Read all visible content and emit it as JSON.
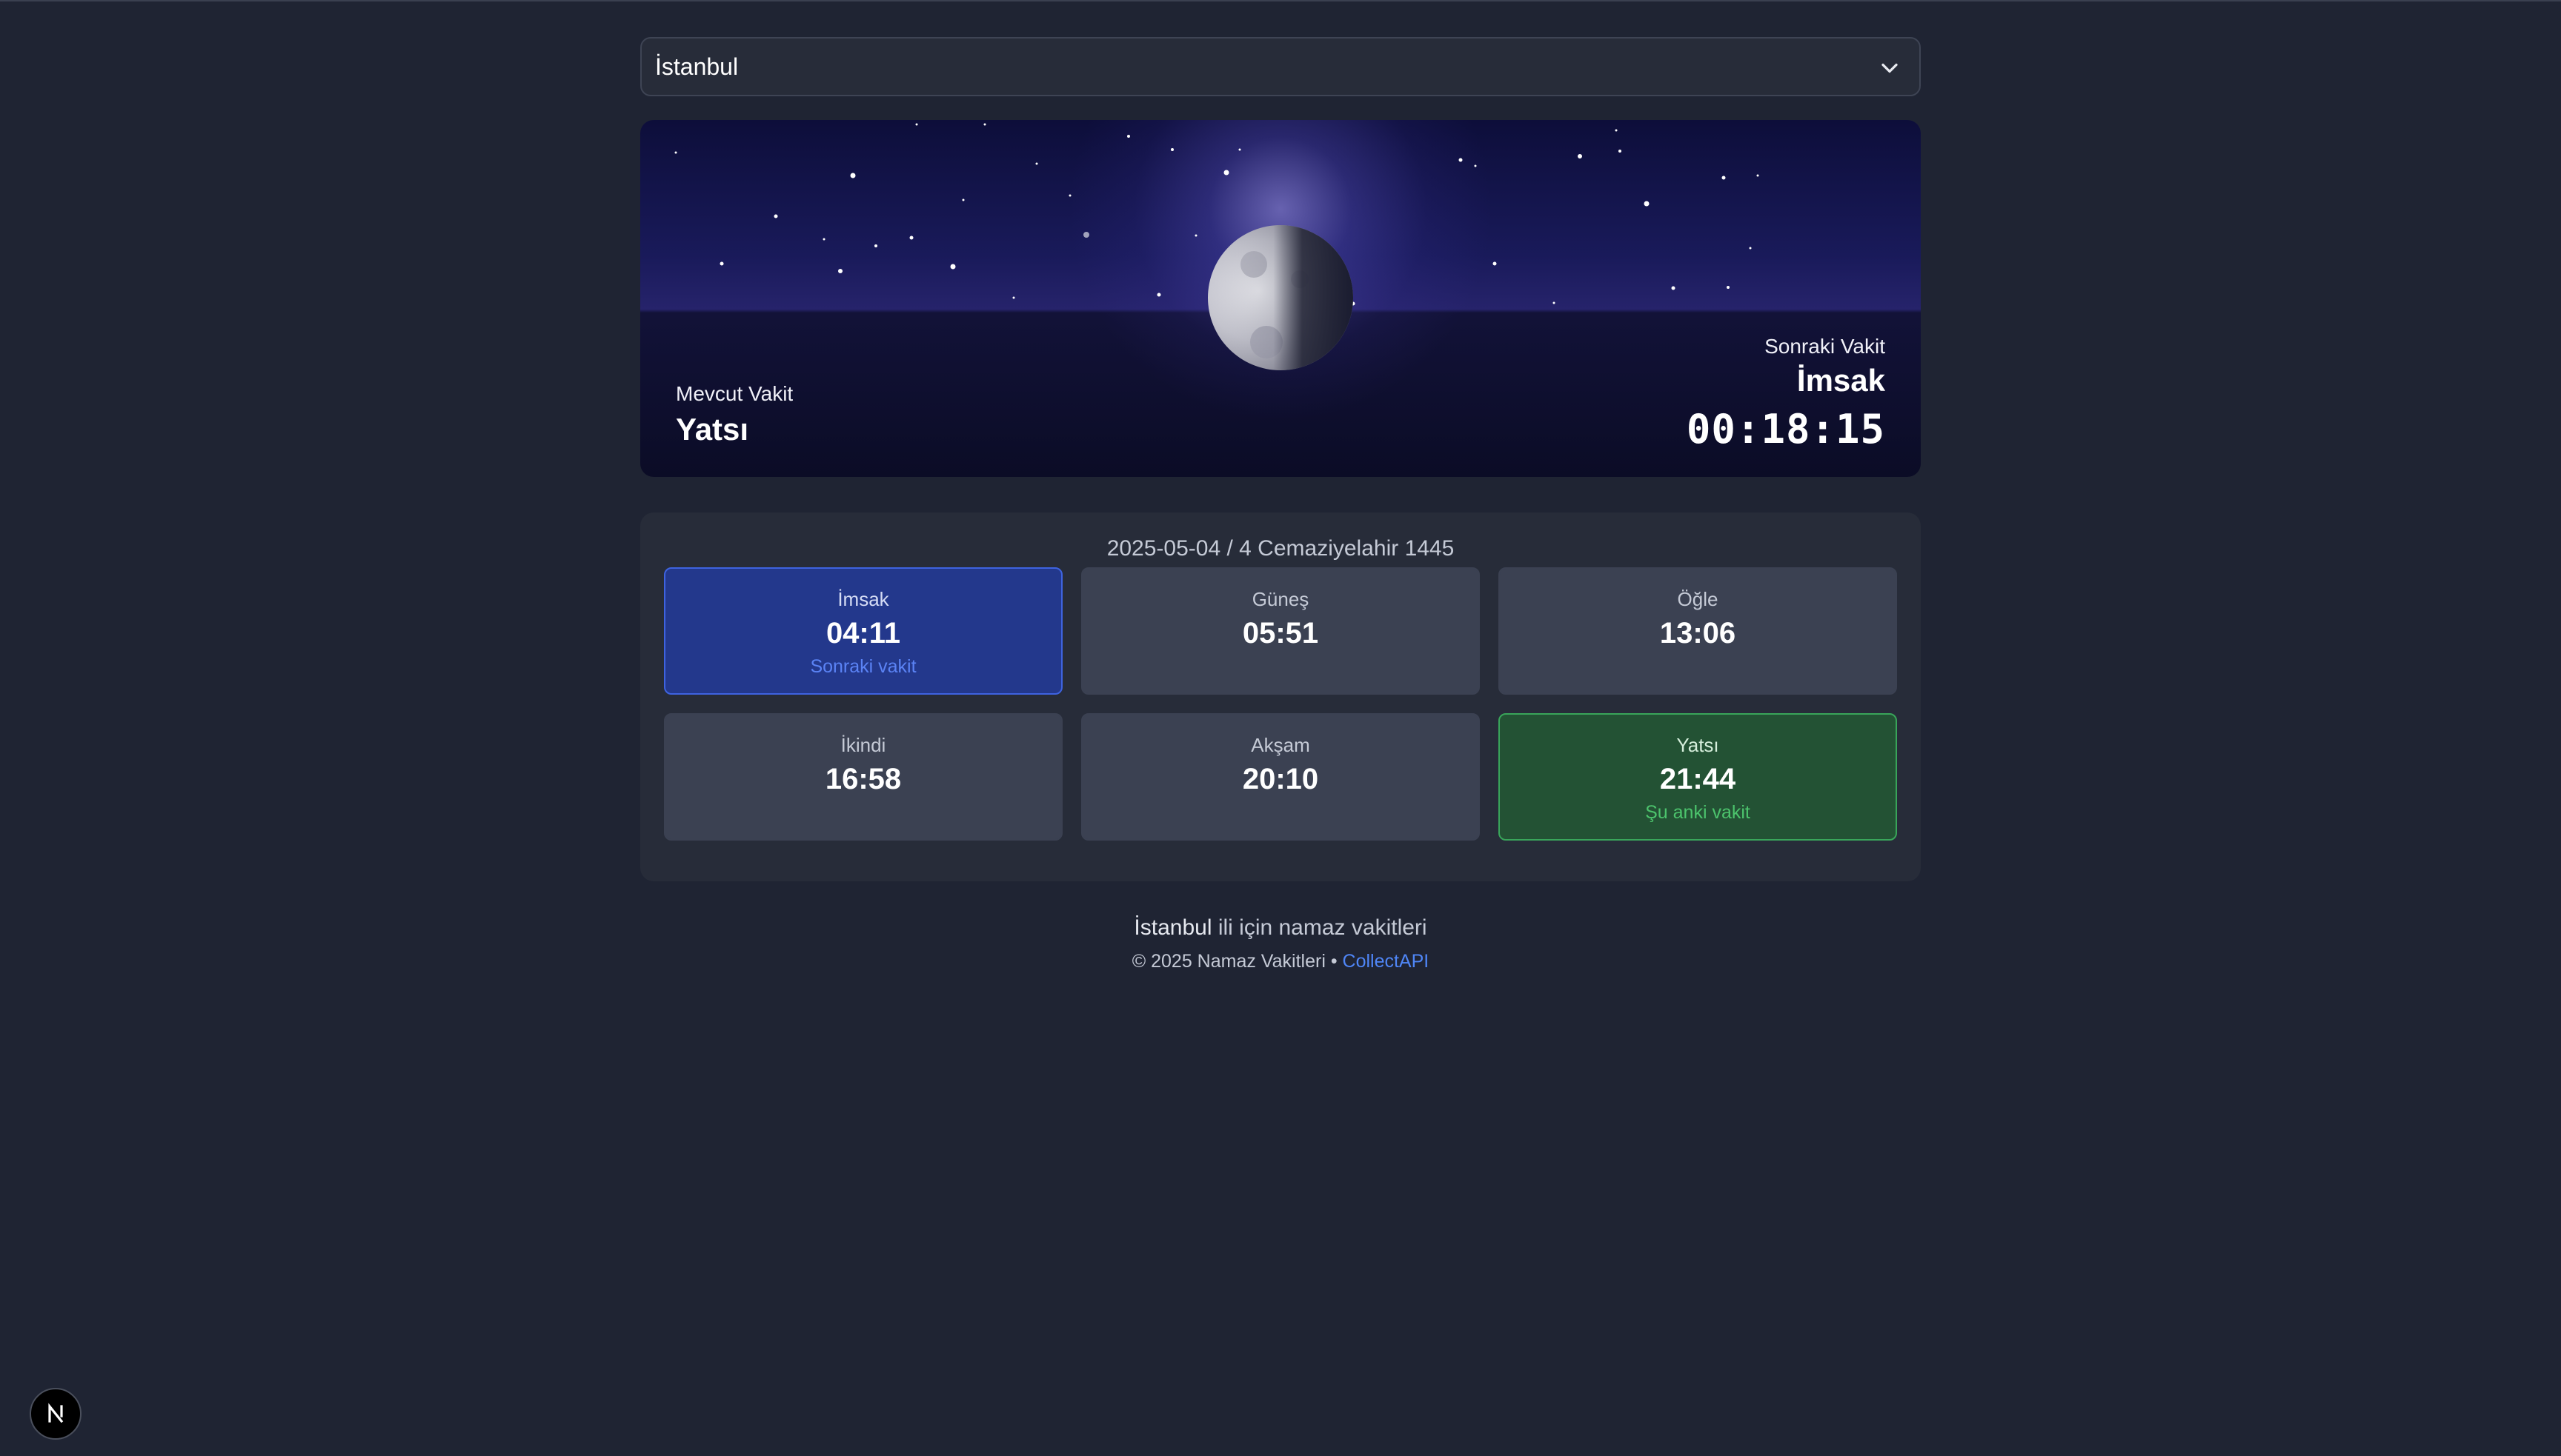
{
  "city_select": {
    "value": "İstanbul",
    "icon": "chevron-down-icon"
  },
  "hero": {
    "current_label": "Mevcut Vakit",
    "current_name": "Yatsı",
    "next_label": "Sonraki Vakit",
    "next_name": "İmsak",
    "countdown": "00:18:15"
  },
  "times": {
    "date": "2025-05-04 / 4 Cemaziyelahir 1445",
    "cards": [
      {
        "name": "İmsak",
        "time": "04:11",
        "status": "Sonraki vakit",
        "state": "next"
      },
      {
        "name": "Güneş",
        "time": "05:51",
        "status": "",
        "state": ""
      },
      {
        "name": "Öğle",
        "time": "13:06",
        "status": "",
        "state": ""
      },
      {
        "name": "İkindi",
        "time": "16:58",
        "status": "",
        "state": ""
      },
      {
        "name": "Akşam",
        "time": "20:10",
        "status": "",
        "state": ""
      },
      {
        "name": "Yatsı",
        "time": "21:44",
        "status": "Şu anki vakit",
        "state": "current"
      }
    ]
  },
  "footer": {
    "city": "İstanbul",
    "rest": " ili için namaz vakitleri",
    "copyright": "© 2025 Namaz Vakitleri • ",
    "link": "CollectAPI"
  },
  "colors": {
    "background": "#1f2433",
    "next_card": "#23388c",
    "current_card": "#235234",
    "link": "#4f86f7"
  }
}
